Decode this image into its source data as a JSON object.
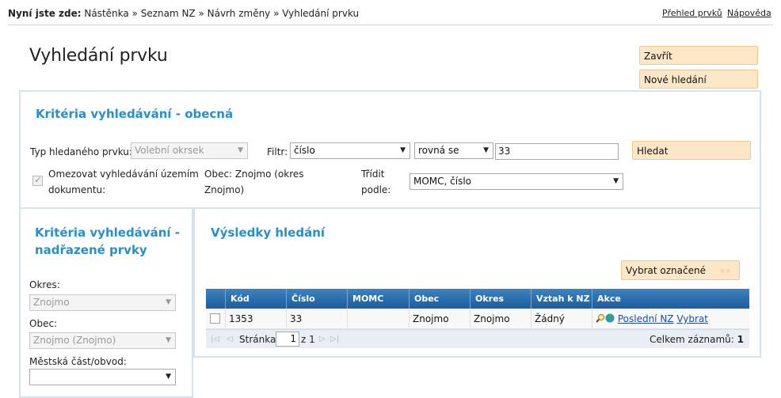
{
  "breadcrumb": {
    "prefix": "Nyní jste zde:",
    "path": "Nástěnka » Seznam NZ » Návrh změny » Vyhledání prvku"
  },
  "top_links": {
    "overview": "Přehled prvků",
    "help": "Nápověda"
  },
  "page": {
    "title": "Vyhledání prvku"
  },
  "actions": {
    "close": "Zavřít",
    "new_search": "Nové hledání"
  },
  "general_criteria": {
    "title": "Kritéria vyhledávání - obecná",
    "type_label": "Typ hledaného prvku:",
    "type_value": "Volební okrsek",
    "filter_label": "Filtr:",
    "filter_field": "číslo",
    "filter_operator": "rovná se",
    "filter_value": "33",
    "search_button": "Hledat",
    "limit_label_line1": "Omezovat vyhledávání územím",
    "limit_label_line2": "dokumentu:",
    "municipality_line1": "Obec: Znojmo (okres",
    "municipality_line2": "Znojmo)",
    "sort_label_line1": "Třídit",
    "sort_label_line2": "podle:",
    "sort_value": "MOMC, číslo"
  },
  "parent_criteria": {
    "title_line1": "Kritéria vyhledávání -",
    "title_line2": "nadřazené prvky",
    "district_label": "Okres:",
    "district_value": "Znojmo",
    "municipality_label": "Obec:",
    "municipality_value": "Znojmo (Znojmo)",
    "city_part_label": "Městská část/obvod:",
    "city_part_value": ""
  },
  "results": {
    "title": "Výsledky hledání",
    "select_marked": "Vybrat označené",
    "select_marked_arrows": "»»",
    "columns": [
      "Kód",
      "Číslo",
      "MOMC",
      "Obec",
      "Okres",
      "Vztah k NZ",
      "Akce"
    ],
    "rows": [
      {
        "code": "1353",
        "number": "33",
        "momc": "",
        "municipality": "Znojmo",
        "district": "Znojmo",
        "relation": "Žádný",
        "action_last": "Poslední NZ",
        "action_select": "Vybrat"
      }
    ],
    "pager": {
      "page_label": "Stránka",
      "page_value": "1",
      "of_text": "z 1",
      "total_label": "Celkem záznamů:",
      "total_value": "1"
    }
  },
  "icons": {
    "pager_first": "first-page-icon",
    "pager_prev": "prev-page-icon",
    "pager_next": "next-page-icon",
    "pager_last": "last-page-icon",
    "detail": "magnifier-icon",
    "map": "globe-icon"
  },
  "colors": {
    "accent_title": "#2a8fc7",
    "button_bg": "#fde7c7",
    "grid_header": "#2a6fb0",
    "panel_border": "#d5e3f0"
  }
}
